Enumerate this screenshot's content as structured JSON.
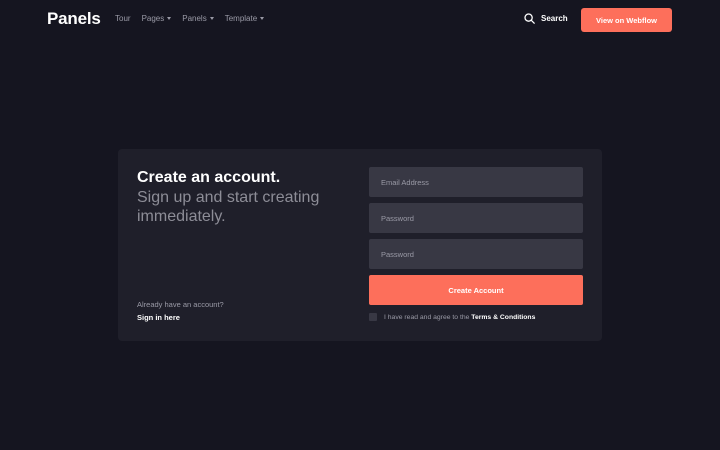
{
  "nav": {
    "logo": "Panels",
    "links": [
      {
        "label": "Tour"
      },
      {
        "label": "Pages"
      },
      {
        "label": "Panels"
      },
      {
        "label": "Template"
      }
    ],
    "search_label": "Search",
    "cta_label": "View on Webflow",
    "accent_color": "#fd6f5b"
  },
  "card": {
    "title": "Create an account.",
    "subtitle": "Sign up and start creating immediately.",
    "already_text": "Already have an account?",
    "signin_label": "Sign in here",
    "fields": [
      {
        "placeholder": "Email Address",
        "value": ""
      },
      {
        "placeholder": "Password",
        "value": ""
      },
      {
        "placeholder": "Password",
        "value": ""
      }
    ],
    "submit_label": "Create Account",
    "agree_text": "I have read and agree to the",
    "terms_label": "Terms & Conditions"
  }
}
